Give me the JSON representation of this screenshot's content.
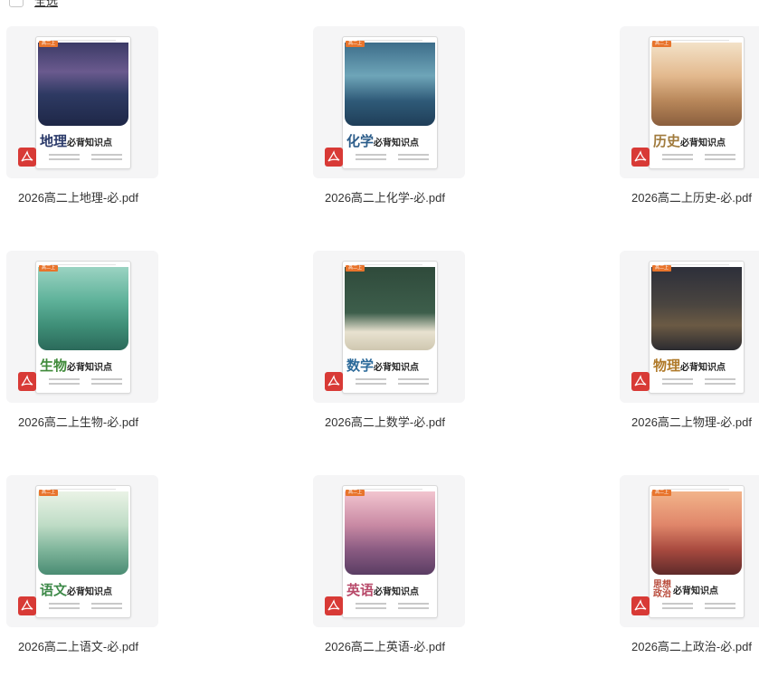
{
  "header": {
    "select_all_label": "全选"
  },
  "files": [
    {
      "name": "2026高二上地理-必.pdf",
      "subject": "地理",
      "subtitle": "必背知识点",
      "grade_tag": "高二上",
      "subject_color": "#2b3a6a",
      "art": "art-geo"
    },
    {
      "name": "2026高二上化学-必.pdf",
      "subject": "化学",
      "subtitle": "必背知识点",
      "grade_tag": "高二上",
      "subject_color": "#2c5d8a",
      "art": "art-chem"
    },
    {
      "name": "2026高二上历史-必.pdf",
      "subject": "历史",
      "subtitle": "必背知识点",
      "grade_tag": "高二上",
      "subject_color": "#a07a3c",
      "art": "art-hist"
    },
    {
      "name": "2026高二上生物-必.pdf",
      "subject": "生物",
      "subtitle": "必背知识点",
      "grade_tag": "高二上",
      "subject_color": "#3f8a3a",
      "art": "art-bio"
    },
    {
      "name": "2026高二上数学-必.pdf",
      "subject": "数学",
      "subtitle": "必背知识点",
      "grade_tag": "高二上",
      "subject_color": "#2c6a9a",
      "art": "art-math"
    },
    {
      "name": "2026高二上物理-必.pdf",
      "subject": "物理",
      "subtitle": "必背知识点",
      "grade_tag": "高二上",
      "subject_color": "#b07a2a",
      "art": "art-phys"
    },
    {
      "name": "2026高二上语文-必.pdf",
      "subject": "语文",
      "subtitle": "必背知识点",
      "grade_tag": "高二上",
      "subject_color": "#3f8a4a",
      "art": "art-chin"
    },
    {
      "name": "2026高二上英语-必.pdf",
      "subject": "英语",
      "subtitle": "必背知识点",
      "grade_tag": "高二上",
      "subject_color": "#b84a6a",
      "art": "art-eng"
    },
    {
      "name": "2026高二上政治-必.pdf",
      "subject": "思想政治",
      "subtitle": "必背知识点",
      "grade_tag": "高二上",
      "subject_color": "#b84a3a",
      "art": "art-pol"
    }
  ],
  "icons": {
    "file_type": "pdf-icon",
    "file_type_color": "#d83a36"
  }
}
